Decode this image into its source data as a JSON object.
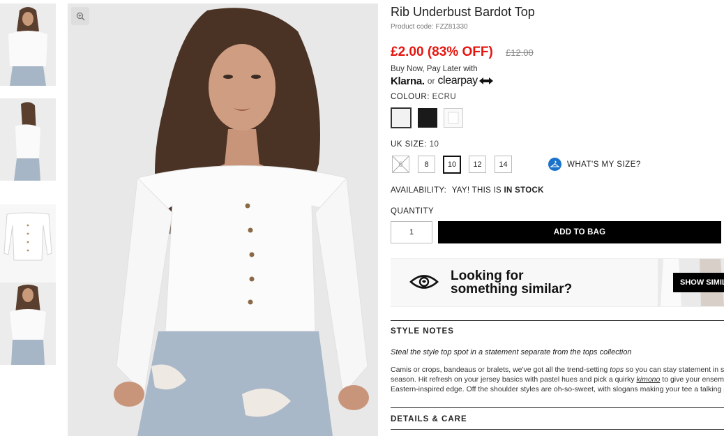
{
  "product": {
    "title": "Rib Underbust Bardot Top",
    "code": "Product code: FZZ81330",
    "price_now": "£2.00 (83% OFF)",
    "price_was": "£12.00",
    "bnpl_text": "Buy Now, Pay Later with",
    "klarna": "Klarna.",
    "or": "or",
    "clearpay": "clearpay"
  },
  "colour": {
    "label": "COLOUR:",
    "value": "ECRU",
    "swatches": [
      {
        "name": "ecru",
        "color": "#f2f2f2",
        "selected": true
      },
      {
        "name": "black",
        "color": "#1a1a1a",
        "selected": false
      },
      {
        "name": "white",
        "color": "#fafafa",
        "selected": false
      }
    ]
  },
  "size": {
    "label": "UK SIZE:",
    "value": "10",
    "options": [
      "6",
      "8",
      "10",
      "12",
      "14"
    ],
    "whats_my_size": "WHAT'S MY SIZE?"
  },
  "availability": {
    "label": "AVAILABILITY:",
    "text": "YAY! THIS IS",
    "status": "IN STOCK"
  },
  "quantity": {
    "label": "QUANTITY",
    "value": "1"
  },
  "add_to_bag": "ADD TO BAG",
  "similar": {
    "line1": "Looking for",
    "line2": "something similar?",
    "button": "SHOW SIMILAR"
  },
  "style_notes": {
    "title": "STYLE NOTES",
    "subtitle": "Steal the style top spot in a statement separate from the tops collection",
    "line1_a": "Camis or crops, bandeaus or bralets, we've got all the trend-setting ",
    "line1_link": "tops",
    "line1_b": " so you can stay statement in separates this",
    "line2_a": "season. Hit refresh on your jersey basics with pastel hues and pick a quirky ",
    "line2_link": "kimono",
    "line2_b": " to give your ensemble that",
    "line3": "Eastern-inspired edge. Off the shoulder styles are oh-so-sweet, with slogans making your tee a talking point."
  },
  "details_care": {
    "title": "DETAILS & CARE"
  },
  "icons": {
    "zoom": "zoom-icon",
    "hanger": "hanger-icon",
    "eye": "eye-icon"
  }
}
